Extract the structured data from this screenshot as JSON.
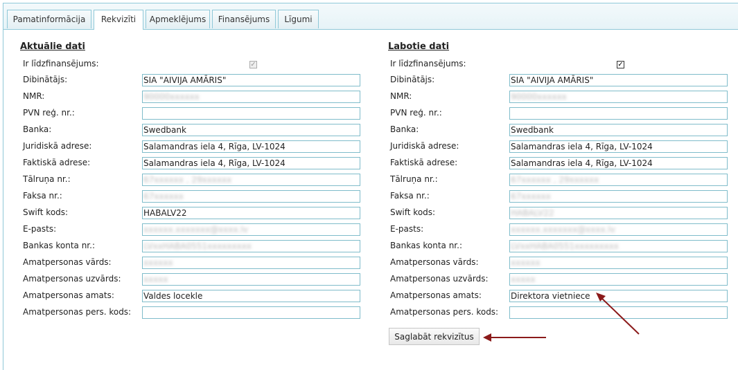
{
  "tabs": [
    {
      "label": "Pamatinformācija"
    },
    {
      "label": "Rekvizīti"
    },
    {
      "label": "Apmeklējums"
    },
    {
      "label": "Finansējums"
    },
    {
      "label": "Līgumi"
    }
  ],
  "left": {
    "title": "Aktuālie dati",
    "labels": {
      "cofinanced": "Ir līdzfinansējums:",
      "founder": "Dibinātājs:",
      "nmr": "NMR:",
      "vat": "PVN reģ. nr.:",
      "bank": "Banka:",
      "legal_address": "Juridiskā adrese:",
      "actual_address": "Faktiskā adrese:",
      "phone": "Tālruņa nr.:",
      "fax": "Faksa nr.:",
      "swift": "Swift kods:",
      "email": "E-pasts:",
      "account": "Bankas konta nr.:",
      "official_name": "Amatpersonas vārds:",
      "official_surname": "Amatpersonas uzvārds:",
      "official_position": "Amatpersonas amats:",
      "official_id": "Amatpersonas pers. kods:"
    },
    "values": {
      "cofinanced_checked": "✓",
      "founder": "SIA \"AIVIJA AMĀRIS\"",
      "nmr": "90000xxxxxx",
      "vat": "",
      "bank": "Swedbank",
      "legal_address": "Salamandras iela 4, Rīga, LV-1024",
      "actual_address": "Salamandras iela 4, Rīga, LV-1024",
      "phone": "67xxxxxx , 29xxxxxx",
      "fax": "67xxxxxx",
      "swift": "HABALV22",
      "email": "xxxxxx.xxxxxxx@xxxx.lv",
      "account": "LVxxHABA0551xxxxxxxxx",
      "official_name": "xxxxxx",
      "official_surname": "xxxxx",
      "official_position": "Valdes locekle",
      "official_id": ""
    }
  },
  "right": {
    "title": "Labotie dati",
    "labels": {
      "cofinanced": "Ir līdzfinansējums:",
      "founder": "Dibinātājs:",
      "nmr": "NMR:",
      "vat": "PVN reģ. nr.:",
      "bank": "Banka:",
      "legal_address": "Juridiskā adrese:",
      "actual_address": "Faktiskā adrese:",
      "phone": "Tālruņa nr.:",
      "fax": "Faksa nr.:",
      "swift": "Swift kods:",
      "email": "E-pasts:",
      "account": "Bankas konta nr.:",
      "official_name": "Amatpersonas vārds:",
      "official_surname": "Amatpersonas uzvārds:",
      "official_position": "Amatpersonas amats:",
      "official_id": "Amatpersonas pers. kods:"
    },
    "values": {
      "cofinanced_checked": "✓",
      "founder": "SIA \"AIVIJA AMĀRIS\"",
      "nmr": "90000xxxxxx",
      "vat": "",
      "bank": "Swedbank",
      "legal_address": "Salamandras iela 4, Rīga, LV-1024",
      "actual_address": "Salamandras iela 4, Rīga, LV-1024",
      "phone": "67xxxxxx , 29xxxxxx",
      "fax": "67xxxxxx",
      "swift": "HABALV22",
      "email": "xxxxxx.xxxxxxx@xxxx.lv",
      "account": "LVxxHABA0551xxxxxxxxx",
      "official_name": "xxxxxx",
      "official_surname": "xxxxx",
      "official_position": "Direktora vietniece",
      "official_id": ""
    }
  },
  "save_label": "Saglabāt rekvizītus",
  "colors": {
    "border": "#7fbcca",
    "annotation_arrow": "#8b1a1a"
  }
}
